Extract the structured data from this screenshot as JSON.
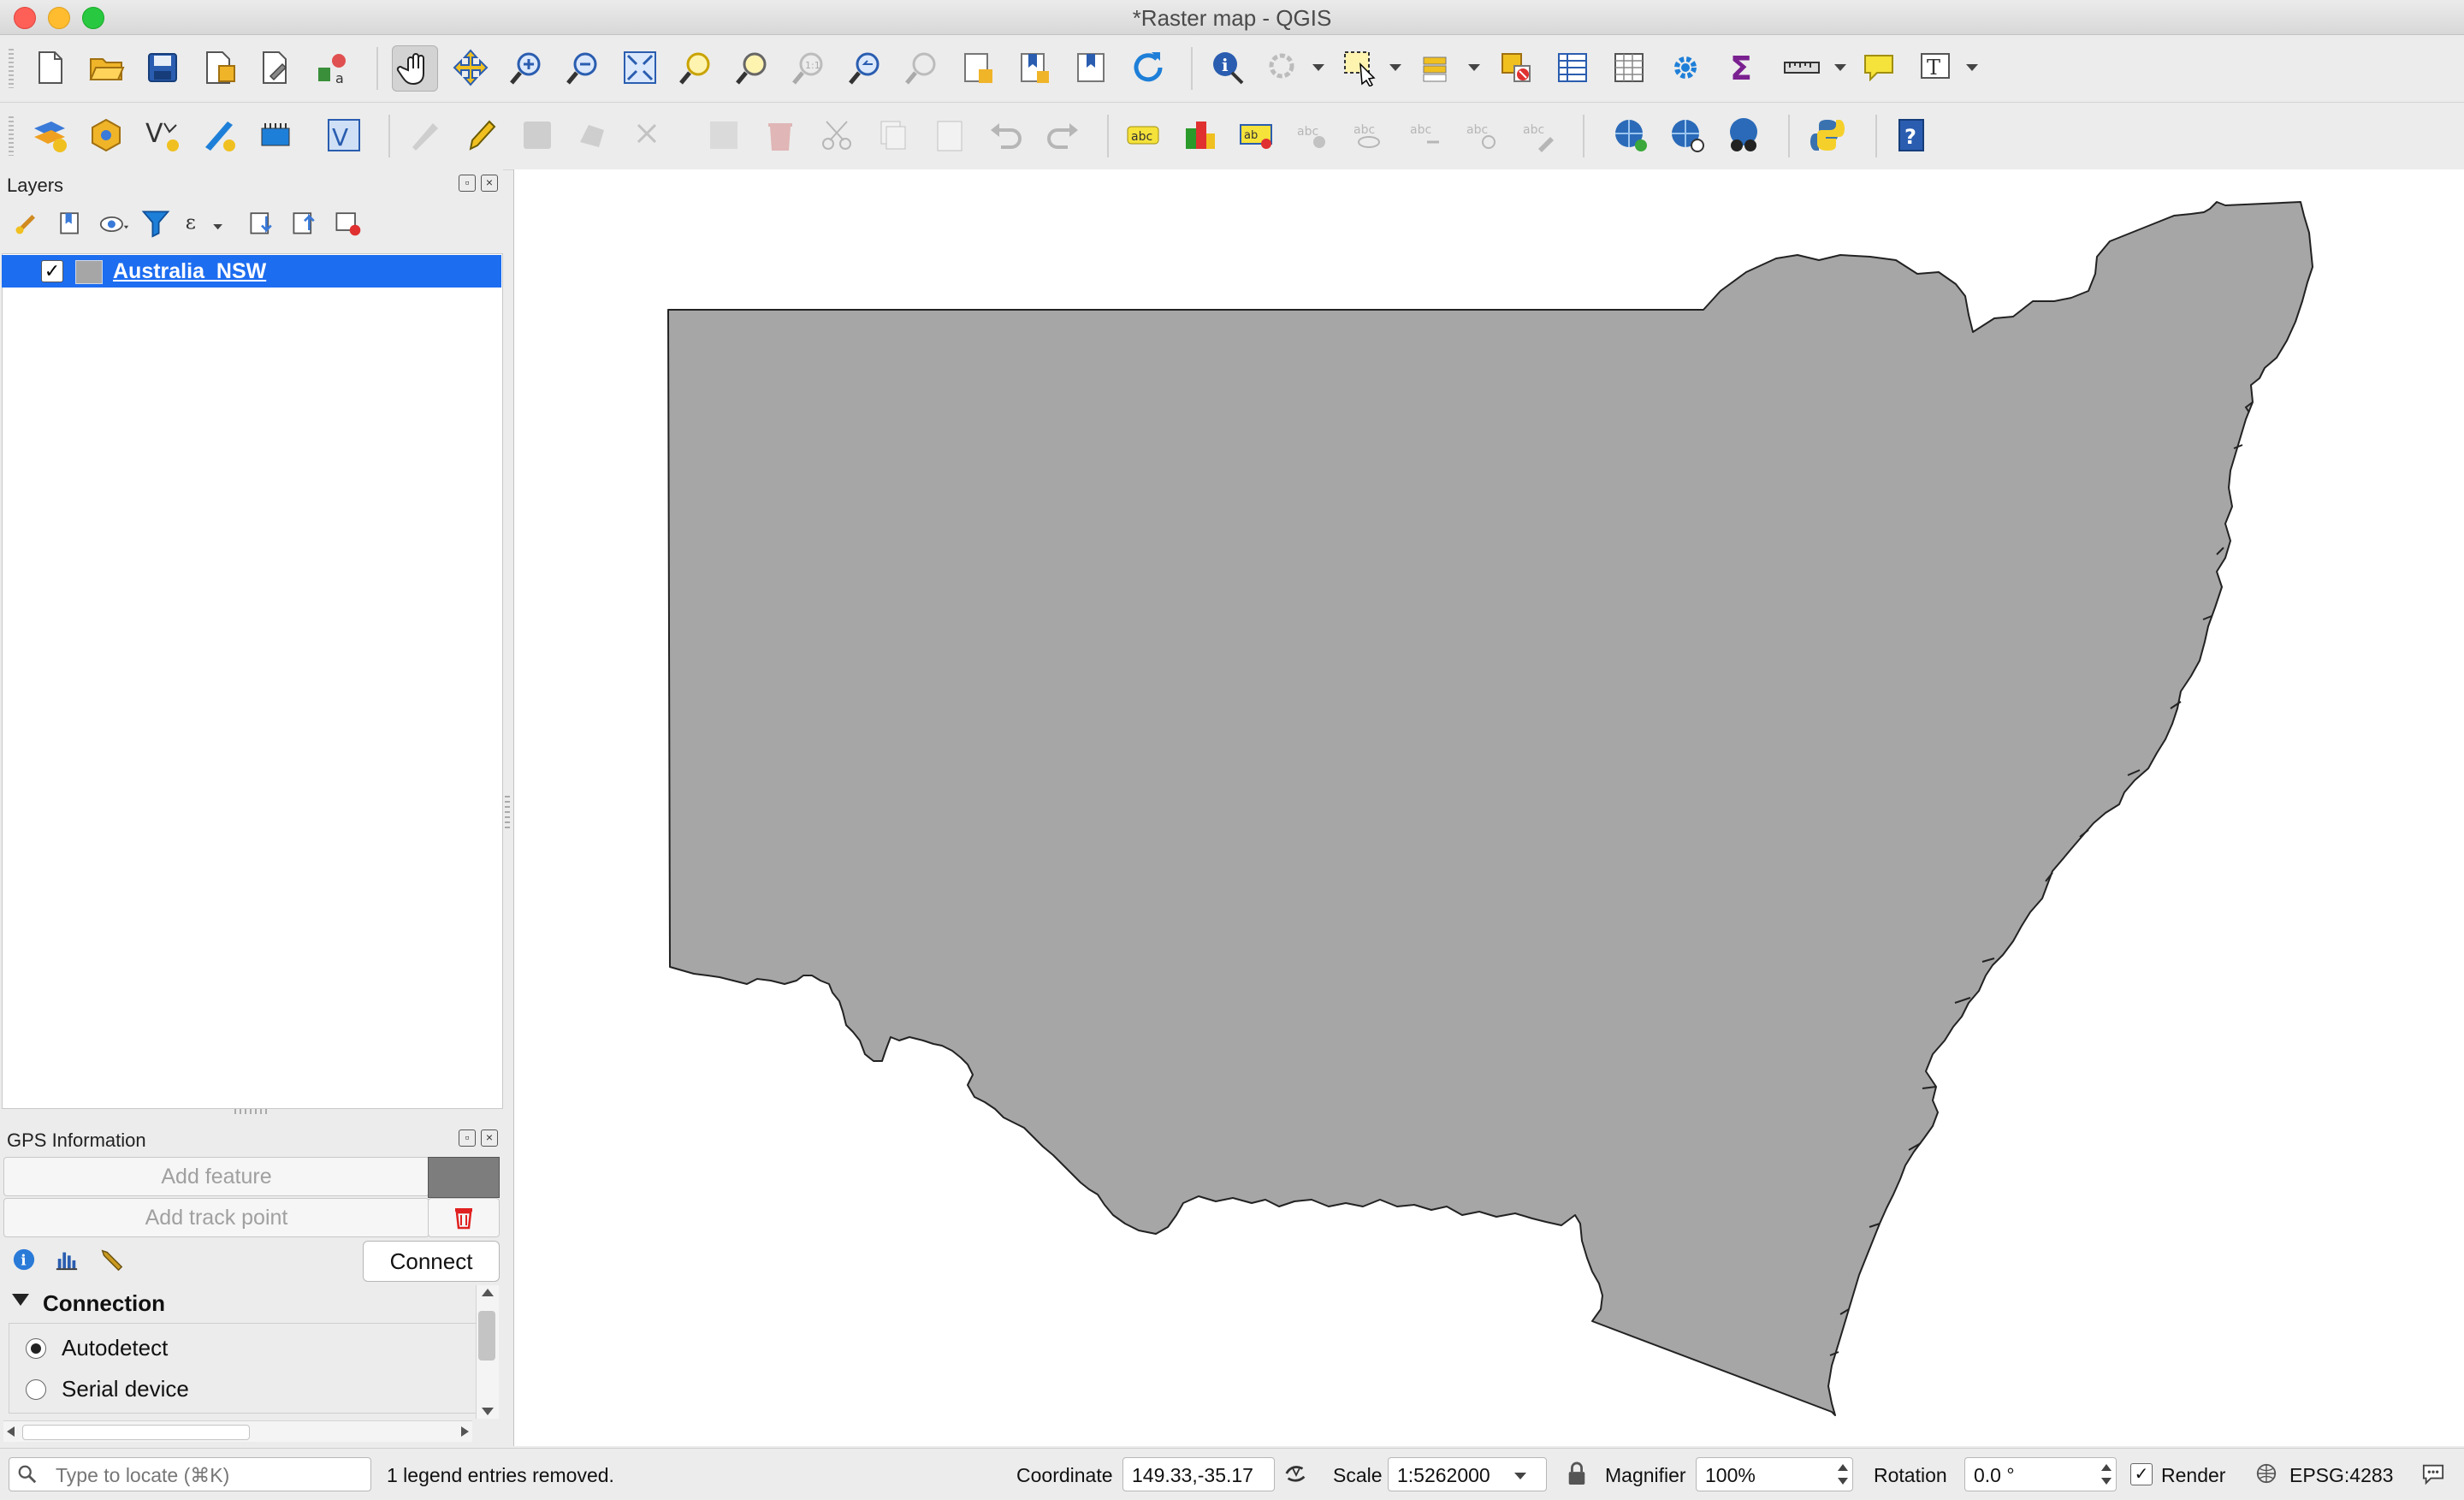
{
  "window": {
    "title": "*Raster map - QGIS"
  },
  "toolbar1": {
    "icons": [
      "new-project-icon",
      "open-project-icon",
      "save-project-icon",
      "save-as-icon",
      "project-properties-icon",
      "style-manager-icon",
      "pan-icon",
      "pan-to-selection-icon",
      "zoom-in-icon",
      "zoom-out-icon",
      "zoom-full-icon",
      "zoom-to-selection-icon",
      "zoom-to-layer-icon",
      "zoom-native-icon",
      "zoom-last-icon",
      "zoom-next-icon",
      "new-map-view-icon",
      "new-bookmark-icon",
      "show-bookmarks-icon",
      "refresh-icon",
      "identify-icon",
      "action-icon",
      "select-features-icon",
      "select-by-location-icon",
      "deselect-icon",
      "attribute-table-icon",
      "field-calculator-icon",
      "processing-toolbox-icon",
      "statistics-icon",
      "measure-icon",
      "map-tips-icon",
      "text-annotation-icon"
    ]
  },
  "toolbar2": {
    "icons": [
      "data-source-manager-icon",
      "new-geopackage-icon",
      "new-shapefile-icon",
      "digitize-icon",
      "new-virtual-layer-icon",
      "vertex-tool-icon",
      "edits-icon",
      "toggle-editing-icon",
      "save-edits-icon",
      "add-feature-icon",
      "node-tool-icon",
      "modify-attributes-icon",
      "delete-icon",
      "cut-icon",
      "copy-icon",
      "paste-icon",
      "undo-icon",
      "redo-icon",
      "label-icon",
      "diagram-icon",
      "pin-label-icon",
      "highlight-label-icon",
      "show-hide-label-icon",
      "move-label-icon",
      "rotate-label-icon",
      "change-label-icon",
      "metasearch-icon",
      "wms-icon",
      "gps-icon",
      "python-console-icon",
      "help-icon"
    ]
  },
  "layers_panel": {
    "title": "Layers",
    "layers": [
      {
        "name": "Australia_NSW",
        "checked": true,
        "swatch_color": "#a6a6a6",
        "selected": true
      }
    ]
  },
  "gps_panel": {
    "title": "GPS Information",
    "add_feature_label": "Add feature",
    "add_track_point_label": "Add track point",
    "connect_label": "Connect",
    "section_title": "Connection",
    "options": [
      {
        "label": "Autodetect",
        "selected": true
      },
      {
        "label": "Serial device",
        "selected": false
      }
    ]
  },
  "map": {
    "fill_color": "#a6a6a6",
    "stroke_color": "#222222",
    "feature": "Australia_NSW"
  },
  "statusbar": {
    "locate_placeholder": "Type to locate (⌘K)",
    "message": "1 legend entries removed.",
    "coordinate_label": "Coordinate",
    "coordinate_value": "149.33,-35.17",
    "scale_label": "Scale",
    "scale_value": "1:5262000",
    "magnifier_label": "Magnifier",
    "magnifier_value": "100%",
    "rotation_label": "Rotation",
    "rotation_value": "0.0 °",
    "render_label": "Render",
    "render_checked": true,
    "crs": "EPSG:4283"
  }
}
